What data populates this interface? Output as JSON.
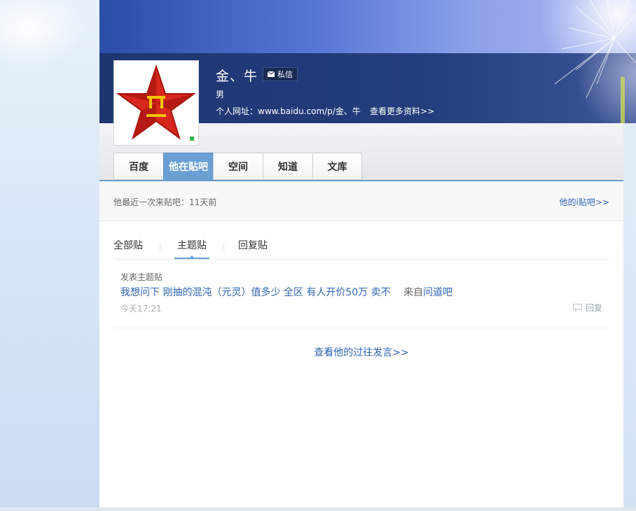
{
  "profile": {
    "username": "金、牛",
    "message_label": "私信",
    "gender": "男",
    "url_label": "个人网址：",
    "url_value": "www.baidu.com/p/金、牛",
    "more_info": "查看更多资料>>"
  },
  "tabs": [
    {
      "label": "百度"
    },
    {
      "label": "他在贴吧"
    },
    {
      "label": "空间"
    },
    {
      "label": "知道"
    },
    {
      "label": "文库"
    }
  ],
  "recent": {
    "text": "他最近一次来贴吧：11天前",
    "my_tieba": "他的i贴吧>>"
  },
  "subtabs": [
    {
      "label": "全部贴"
    },
    {
      "label": "主题贴"
    },
    {
      "label": "回复贴"
    }
  ],
  "post": {
    "type": "发表主题贴",
    "title": "我想问下 刚抽的混沌（元灵）值多少 全区 有人开价50万 卖不",
    "from_prefix": "来自",
    "forum": "问道吧",
    "time": "今天17:21",
    "reply_label": "回复"
  },
  "history_link": "查看他的过往发言>>",
  "colors": {
    "accent": "#6b9fd3",
    "link": "#2d64b3",
    "online": "#39b54a"
  }
}
